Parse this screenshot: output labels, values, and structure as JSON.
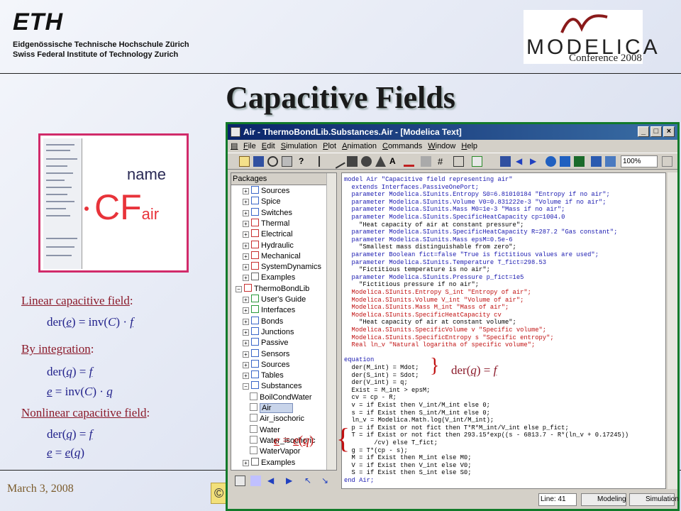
{
  "header": {
    "eth_logo_text": "ETH",
    "eth_line1": "Eidgenössische Technische Hochschule Zürich",
    "eth_line2": "Swiss Federal Institute of Technology Zurich",
    "modelica_logo_text": "MODELICA",
    "conference": "Conference 2008"
  },
  "title": "Capacitive Fields",
  "thumbnail": {
    "name_label": "name",
    "cf_label": "CF",
    "cf_sub": "air"
  },
  "left_content": {
    "heading1": "Linear capacitive field",
    "heading1_colon": ":",
    "eq1": {
      "pre": "der(",
      "var": "e",
      "mid": ") = inv(",
      "C": "C",
      "post": ") · ",
      "f": "f"
    },
    "heading2": "By integration",
    "heading2_colon": ":",
    "eq2": {
      "pre": "der(",
      "q": "q",
      "post": ") = ",
      "f": "f"
    },
    "eq3": {
      "e": "e",
      "mid": " = inv(",
      "C": "C",
      "post": ") · ",
      "q": "q"
    },
    "heading3": "Nonlinear capacitive field",
    "heading3_colon": ":",
    "eq4": {
      "pre": "der(",
      "q": "q",
      "post": ") = ",
      "f": "f"
    },
    "eq5": {
      "e": "e",
      "mid": " = ",
      "fn": "e",
      "paren_open": "(",
      "q": "q",
      "paren_close": ")"
    }
  },
  "footer": {
    "date": "March 3, 2008",
    "copyright_stub": "©"
  },
  "window": {
    "title": "Air - ThermoBondLib.Substances.Air - [Modelica Text]",
    "menu": [
      "File",
      "Edit",
      "Simulation",
      "Plot",
      "Animation",
      "Commands",
      "Window",
      "Help"
    ],
    "zoom": "100%",
    "tree_header": "Packages",
    "tree_items": [
      {
        "label": "Sources",
        "color": "#3a66c8",
        "level": 1
      },
      {
        "label": "Spice",
        "color": "#3a66c8",
        "level": 1
      },
      {
        "label": "Switches",
        "color": "#3a66c8",
        "level": 1
      },
      {
        "label": "Thermal",
        "color": "#c83030",
        "level": 1
      },
      {
        "label": "Electrical",
        "color": "#c83030",
        "level": 1
      },
      {
        "label": "Hydraulic",
        "color": "#c83030",
        "level": 1
      },
      {
        "label": "Mechanical",
        "color": "#c83030",
        "level": 1
      },
      {
        "label": "SystemDynamics",
        "color": "#c83030",
        "level": 1
      },
      {
        "label": "Examples",
        "color": "#666666",
        "level": 1
      },
      {
        "label": "ThermoBondLib",
        "color": "#c83030",
        "level": 0
      },
      {
        "label": "User's Guide",
        "color": "#2a9a3a",
        "level": 1
      },
      {
        "label": "Interfaces",
        "color": "#2a9a3a",
        "level": 1
      },
      {
        "label": "Bonds",
        "color": "#3a66c8",
        "level": 1
      },
      {
        "label": "Junctions",
        "color": "#3a66c8",
        "level": 1
      },
      {
        "label": "Passive",
        "color": "#3a66c8",
        "level": 1
      },
      {
        "label": "Sensors",
        "color": "#3a66c8",
        "level": 1
      },
      {
        "label": "Sources",
        "color": "#3a66c8",
        "level": 1
      },
      {
        "label": "Tables",
        "color": "#3a66c8",
        "level": 1
      },
      {
        "label": "Substances",
        "color": "#3a66c8",
        "level": 1
      },
      {
        "label": "BoilCondWater",
        "color": "#888888",
        "level": 2
      },
      {
        "label": "Air",
        "color": "#888888",
        "level": 2,
        "selected": true
      },
      {
        "label": "Air_isochoric",
        "color": "#888888",
        "level": 2
      },
      {
        "label": "Water",
        "color": "#888888",
        "level": 2
      },
      {
        "label": "Water_isochoric",
        "color": "#888888",
        "level": 2
      },
      {
        "label": "WaterVapor",
        "color": "#888888",
        "level": 2
      },
      {
        "label": "Examples",
        "color": "#666666",
        "level": 1
      }
    ],
    "code_lines": [
      "model Air \"Capacitive field representing air\"",
      "  extends Interfaces.PassiveOnePort;",
      "  parameter Modelica.SIunits.Entropy S0=6.81010184 \"Entropy if no air\";",
      "  parameter Modelica.SIunits.Volume V0=0.831222e-3 \"Volume if no air\";",
      "  parameter Modelica.SIunits.Mass M0=1e-3 \"Mass if no air\";",
      "  parameter Modelica.SIunits.SpecificHeatCapacity cp=1004.0",
      "    \"Heat capacity of air at constant pressure\";",
      "  parameter Modelica.SIunits.SpecificHeatCapacity R=287.2 \"Gas constant\";",
      "  parameter Modelica.SIunits.Mass epsM=0.5e-6",
      "    \"Smallest mass distinguishable from zero\";",
      "  parameter Boolean fict=false \"True is fictitious values are used\";",
      "  parameter Modelica.SIunits.Temperature T_fict=298.53",
      "    \"Fictitious temperature is no air\";",
      "  parameter Modelica.SIunits.Pressure p_fict=1e5",
      "    \"Fictitious pressure if no air\";",
      "  Modelica.SIunits.Entropy S_int \"Entropy of air\";",
      "  Modelica.SIunits.Volume V_int \"Volume of air\";",
      "  Modelica.SIunits.Mass M_int \"Mass of air\";",
      "  Modelica.SIunits.SpecificHeatCapacity cv",
      "    \"Heat capacity of air at constant volume\";",
      "  Modelica.SIunits.SpecificVolume v \"Specific volume\";",
      "  Modelica.SIunits.SpecificEntropy s \"Specific entropy\";",
      "  Real ln_v \"Natural logaritha of specific volume\";",
      "",
      "equation",
      "  der(M_int) = Mdot;",
      "  der(S_int) = Sdot;",
      "  der(V_int) = q;",
      "  Exist = M_int > epsM;",
      "  cv = cp - R;",
      "  v = if Exist then V_int/M_int else 0;",
      "  s = if Exist then S_int/M_int else 0;",
      "  ln_v = Modelica.Math.log(V_int/M_int);",
      "  p = if Exist or not fict then T*R*M_int/V_int else p_fict;",
      "  T = if Exist or not fict then 293.15*exp((s - 6813.7 - R*(ln_v + 0.17245))",
      "        /cv) else T_fict;",
      "  g = T*(cp - s);",
      "  M = if Exist then M_int else M0;",
      "  V = if Exist then V_int else V0;",
      "  S = if Exist then S_int else S0;",
      "end Air;"
    ],
    "status_line": "Line: 41",
    "mode_modeling": "Modeling",
    "mode_simulation": "Simulation"
  },
  "overlays": {
    "der_q_pre": "der(",
    "der_q_q": "q",
    "der_q_post": ") = ",
    "der_q_f": "f",
    "e_eq_e": "e",
    "e_eq_mid": " = ",
    "e_eq_fn": "e",
    "e_eq_open": "(",
    "e_eq_q": "q",
    "e_eq_close": ")"
  },
  "colors": {
    "heading": "#8b1a2a",
    "equation": "#1f1f8a",
    "window_border": "#127a2a",
    "thumbnail_border": "#d12b6a",
    "cf_red": "#e8333a"
  }
}
